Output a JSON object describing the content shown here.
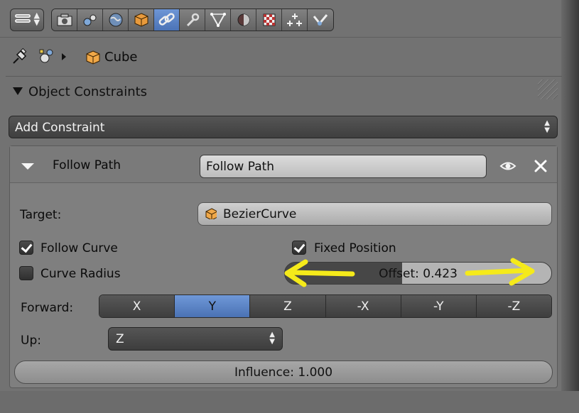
{
  "toolbar": {
    "editor_type_icon": "properties-editor-icon",
    "context_tabs": [
      {
        "icon": "render-icon",
        "active": false
      },
      {
        "icon": "render-layers-icon",
        "active": false
      },
      {
        "icon": "world-icon",
        "active": false
      },
      {
        "icon": "object-icon",
        "active": false
      },
      {
        "icon": "constraints-icon",
        "active": true
      },
      {
        "icon": "modifiers-wrench-icon",
        "active": false
      },
      {
        "icon": "object-data-curve-icon",
        "active": false
      },
      {
        "icon": "material-icon",
        "active": false
      },
      {
        "icon": "texture-icon",
        "active": false
      },
      {
        "icon": "particles-icon",
        "active": false
      },
      {
        "icon": "physics-icon",
        "active": false
      }
    ],
    "accent_color": "#5680c2"
  },
  "breadcrumb": {
    "object_name": "Cube"
  },
  "panel": {
    "title": "Object Constraints",
    "add_constraint_label": "Add Constraint"
  },
  "constraint": {
    "type_label": "Follow Path",
    "name_value": "Follow Path",
    "target_label": "Target:",
    "target_value": "BezierCurve",
    "follow_curve_label": "Follow Curve",
    "follow_curve_checked": true,
    "fixed_position_label": "Fixed Position",
    "fixed_position_checked": true,
    "curve_radius_label": "Curve Radius",
    "curve_radius_checked": false,
    "offset_text": "Offset: 0.423",
    "offset_value": 0.423,
    "forward_label": "Forward:",
    "forward_axes": [
      "X",
      "Y",
      "Z",
      "-X",
      "-Y",
      "-Z"
    ],
    "forward_selected": "Y",
    "up_label": "Up:",
    "up_value": "Z",
    "influence_text": "Influence: 1.000",
    "influence_value": 1.0
  },
  "annotation": {
    "arrow_color": "#f5ea1a"
  }
}
